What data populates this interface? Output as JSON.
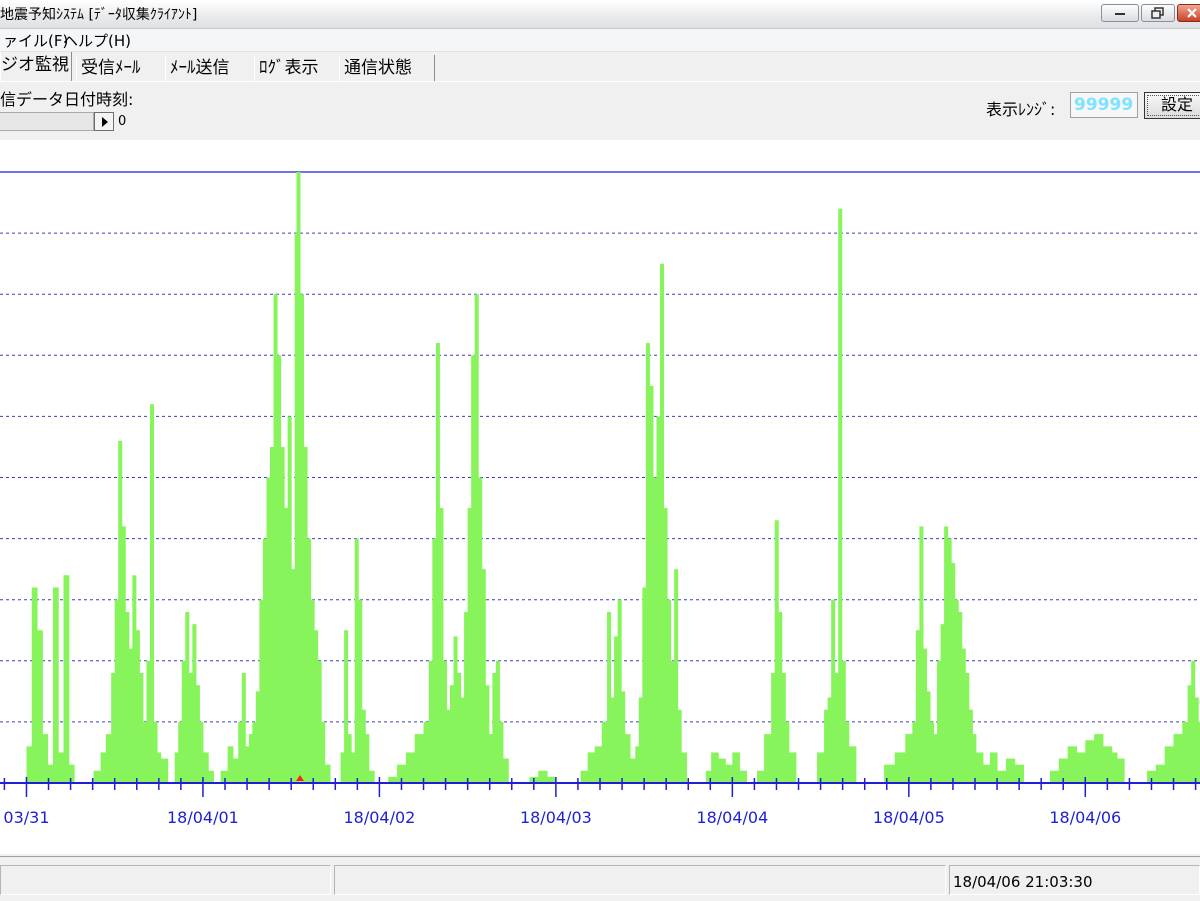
{
  "window": {
    "title": "地震予知ｼｽﾃﾑ [ﾃﾞｰﾀ収集ｸﾗｲｱﾝﾄ]"
  },
  "menu": {
    "items": [
      {
        "label": "ァイル(F)"
      },
      {
        "label": "ヘルプ(H)"
      }
    ]
  },
  "tabs": {
    "items": [
      {
        "label": "ジオ監視",
        "active": true
      },
      {
        "label": "受信ﾒｰﾙ",
        "active": false
      },
      {
        "label": "ﾒｰﾙ送信",
        "active": false
      },
      {
        "label": "ﾛｸﾞ表示",
        "active": false
      },
      {
        "label": "通信状態",
        "active": false
      }
    ]
  },
  "toolbar": {
    "received_datetime_label": "信データ日付時刻:",
    "slider_value": "0",
    "display_range_label": "表示ﾚﾝｼﾞ:",
    "display_range_value": "99999",
    "set_button_label": "設定"
  },
  "chart_data": {
    "type": "area",
    "x_tick_labels": [
      "03/31",
      "18/04/01",
      "18/04/02",
      "18/04/03",
      "18/04/04",
      "18/04/05",
      "18/04/06"
    ],
    "x_range_days": [
      -0.15,
      6.65
    ],
    "minor_ticks_per_day": 8,
    "y_gridlines": 10,
    "grid": true,
    "colors": {
      "fill": "#86f45a",
      "grid": "#3c3cc8",
      "axis": "#1f1fd6",
      "marker": "#ff2020"
    },
    "series": [
      {
        "values": [
          [
            0.0,
            0.06
          ],
          [
            0.03,
            0.32
          ],
          [
            0.06,
            0.25
          ],
          [
            0.09,
            0.08
          ],
          [
            0.12,
            0.03
          ],
          [
            0.15,
            0.32
          ],
          [
            0.18,
            0.05
          ],
          [
            0.21,
            0.34
          ],
          [
            0.24,
            0.03
          ],
          [
            0.27,
            0.0
          ],
          [
            0.35,
            0.0
          ],
          [
            0.38,
            0.02
          ],
          [
            0.42,
            0.05
          ],
          [
            0.45,
            0.08
          ],
          [
            0.48,
            0.18
          ],
          [
            0.5,
            0.3
          ],
          [
            0.52,
            0.56
          ],
          [
            0.54,
            0.42
          ],
          [
            0.56,
            0.28
          ],
          [
            0.58,
            0.22
          ],
          [
            0.6,
            0.34
          ],
          [
            0.62,
            0.25
          ],
          [
            0.64,
            0.18
          ],
          [
            0.66,
            0.1
          ],
          [
            0.68,
            0.2
          ],
          [
            0.7,
            0.62
          ],
          [
            0.72,
            0.1
          ],
          [
            0.74,
            0.05
          ],
          [
            0.76,
            0.04
          ],
          [
            0.8,
            0.0
          ],
          [
            0.84,
            0.05
          ],
          [
            0.86,
            0.1
          ],
          [
            0.88,
            0.2
          ],
          [
            0.9,
            0.28
          ],
          [
            0.92,
            0.18
          ],
          [
            0.94,
            0.26
          ],
          [
            0.96,
            0.16
          ],
          [
            0.98,
            0.1
          ],
          [
            1.0,
            0.05
          ],
          [
            1.03,
            0.02
          ],
          [
            1.06,
            0.0
          ],
          [
            1.1,
            0.02
          ],
          [
            1.14,
            0.06
          ],
          [
            1.17,
            0.04
          ],
          [
            1.2,
            0.1
          ],
          [
            1.22,
            0.18
          ],
          [
            1.24,
            0.06
          ],
          [
            1.26,
            0.08
          ],
          [
            1.28,
            0.1
          ],
          [
            1.3,
            0.15
          ],
          [
            1.32,
            0.3
          ],
          [
            1.34,
            0.4
          ],
          [
            1.36,
            0.5
          ],
          [
            1.38,
            0.55
          ],
          [
            1.4,
            0.8
          ],
          [
            1.42,
            0.7
          ],
          [
            1.44,
            0.55
          ],
          [
            1.46,
            0.45
          ],
          [
            1.48,
            0.6
          ],
          [
            1.5,
            0.35
          ],
          [
            1.52,
            0.9
          ],
          [
            1.53,
            1.0
          ],
          [
            1.55,
            0.8
          ],
          [
            1.57,
            0.55
          ],
          [
            1.59,
            0.4
          ],
          [
            1.61,
            0.3
          ],
          [
            1.63,
            0.25
          ],
          [
            1.65,
            0.2
          ],
          [
            1.67,
            0.1
          ],
          [
            1.69,
            0.03
          ],
          [
            1.72,
            0.0
          ],
          [
            1.78,
            0.05
          ],
          [
            1.8,
            0.25
          ],
          [
            1.82,
            0.08
          ],
          [
            1.84,
            0.05
          ],
          [
            1.86,
            0.4
          ],
          [
            1.88,
            0.3
          ],
          [
            1.9,
            0.12
          ],
          [
            1.92,
            0.08
          ],
          [
            1.94,
            0.02
          ],
          [
            1.97,
            0.0
          ],
          [
            2.05,
            0.01
          ],
          [
            2.1,
            0.03
          ],
          [
            2.15,
            0.05
          ],
          [
            2.2,
            0.08
          ],
          [
            2.25,
            0.1
          ],
          [
            2.28,
            0.2
          ],
          [
            2.3,
            0.4
          ],
          [
            2.32,
            0.72
          ],
          [
            2.34,
            0.45
          ],
          [
            2.36,
            0.2
          ],
          [
            2.38,
            0.12
          ],
          [
            2.4,
            0.16
          ],
          [
            2.42,
            0.24
          ],
          [
            2.44,
            0.18
          ],
          [
            2.46,
            0.14
          ],
          [
            2.48,
            0.28
          ],
          [
            2.5,
            0.45
          ],
          [
            2.52,
            0.7
          ],
          [
            2.54,
            0.8
          ],
          [
            2.56,
            0.5
          ],
          [
            2.58,
            0.35
          ],
          [
            2.6,
            0.16
          ],
          [
            2.62,
            0.08
          ],
          [
            2.64,
            0.18
          ],
          [
            2.66,
            0.2
          ],
          [
            2.68,
            0.1
          ],
          [
            2.7,
            0.04
          ],
          [
            2.73,
            0.0
          ],
          [
            2.8,
            0.0
          ],
          [
            2.85,
            0.01
          ],
          [
            2.9,
            0.02
          ],
          [
            2.95,
            0.01
          ],
          [
            3.0,
            0.0
          ],
          [
            3.1,
            0.0
          ],
          [
            3.14,
            0.02
          ],
          [
            3.18,
            0.05
          ],
          [
            3.22,
            0.06
          ],
          [
            3.26,
            0.1
          ],
          [
            3.29,
            0.28
          ],
          [
            3.31,
            0.14
          ],
          [
            3.33,
            0.24
          ],
          [
            3.35,
            0.3
          ],
          [
            3.37,
            0.15
          ],
          [
            3.39,
            0.08
          ],
          [
            3.42,
            0.04
          ],
          [
            3.45,
            0.06
          ],
          [
            3.47,
            0.14
          ],
          [
            3.49,
            0.32
          ],
          [
            3.51,
            0.72
          ],
          [
            3.53,
            0.65
          ],
          [
            3.55,
            0.5
          ],
          [
            3.57,
            0.6
          ],
          [
            3.59,
            0.85
          ],
          [
            3.61,
            0.45
          ],
          [
            3.63,
            0.3
          ],
          [
            3.65,
            0.2
          ],
          [
            3.67,
            0.35
          ],
          [
            3.69,
            0.12
          ],
          [
            3.71,
            0.05
          ],
          [
            3.74,
            0.0
          ],
          [
            3.8,
            0.0
          ],
          [
            3.85,
            0.02
          ],
          [
            3.88,
            0.05
          ],
          [
            3.92,
            0.04
          ],
          [
            3.96,
            0.03
          ],
          [
            4.0,
            0.05
          ],
          [
            4.04,
            0.02
          ],
          [
            4.08,
            0.0
          ],
          [
            4.14,
            0.02
          ],
          [
            4.18,
            0.08
          ],
          [
            4.22,
            0.18
          ],
          [
            4.24,
            0.43
          ],
          [
            4.26,
            0.28
          ],
          [
            4.28,
            0.18
          ],
          [
            4.3,
            0.1
          ],
          [
            4.32,
            0.05
          ],
          [
            4.36,
            0.0
          ],
          [
            4.44,
            0.0
          ],
          [
            4.48,
            0.05
          ],
          [
            4.52,
            0.12
          ],
          [
            4.54,
            0.14
          ],
          [
            4.56,
            0.3
          ],
          [
            4.58,
            0.18
          ],
          [
            4.6,
            0.94
          ],
          [
            4.62,
            0.2
          ],
          [
            4.64,
            0.1
          ],
          [
            4.66,
            0.06
          ],
          [
            4.7,
            0.0
          ],
          [
            4.8,
            0.0
          ],
          [
            4.86,
            0.03
          ],
          [
            4.92,
            0.05
          ],
          [
            4.98,
            0.08
          ],
          [
            5.02,
            0.1
          ],
          [
            5.04,
            0.25
          ],
          [
            5.06,
            0.42
          ],
          [
            5.08,
            0.22
          ],
          [
            5.1,
            0.15
          ],
          [
            5.12,
            0.1
          ],
          [
            5.14,
            0.08
          ],
          [
            5.16,
            0.2
          ],
          [
            5.18,
            0.26
          ],
          [
            5.2,
            0.42
          ],
          [
            5.22,
            0.4
          ],
          [
            5.24,
            0.36
          ],
          [
            5.26,
            0.3
          ],
          [
            5.28,
            0.28
          ],
          [
            5.3,
            0.22
          ],
          [
            5.32,
            0.18
          ],
          [
            5.34,
            0.12
          ],
          [
            5.36,
            0.08
          ],
          [
            5.38,
            0.05
          ],
          [
            5.42,
            0.03
          ],
          [
            5.46,
            0.05
          ],
          [
            5.5,
            0.02
          ],
          [
            5.55,
            0.04
          ],
          [
            5.6,
            0.03
          ],
          [
            5.65,
            0.0
          ],
          [
            5.75,
            0.0
          ],
          [
            5.8,
            0.02
          ],
          [
            5.85,
            0.04
          ],
          [
            5.9,
            0.06
          ],
          [
            5.95,
            0.05
          ],
          [
            6.0,
            0.07
          ],
          [
            6.05,
            0.08
          ],
          [
            6.1,
            0.06
          ],
          [
            6.15,
            0.05
          ],
          [
            6.18,
            0.04
          ],
          [
            6.22,
            0.0
          ],
          [
            6.3,
            0.0
          ],
          [
            6.35,
            0.02
          ],
          [
            6.4,
            0.03
          ],
          [
            6.45,
            0.06
          ],
          [
            6.5,
            0.08
          ],
          [
            6.55,
            0.1
          ],
          [
            6.58,
            0.16
          ],
          [
            6.6,
            0.2
          ],
          [
            6.62,
            0.14
          ],
          [
            6.64,
            0.1
          ],
          [
            6.65,
            0.12
          ]
        ]
      }
    ]
  },
  "statusbar": {
    "datetime": "18/04/06 21:03:30"
  }
}
